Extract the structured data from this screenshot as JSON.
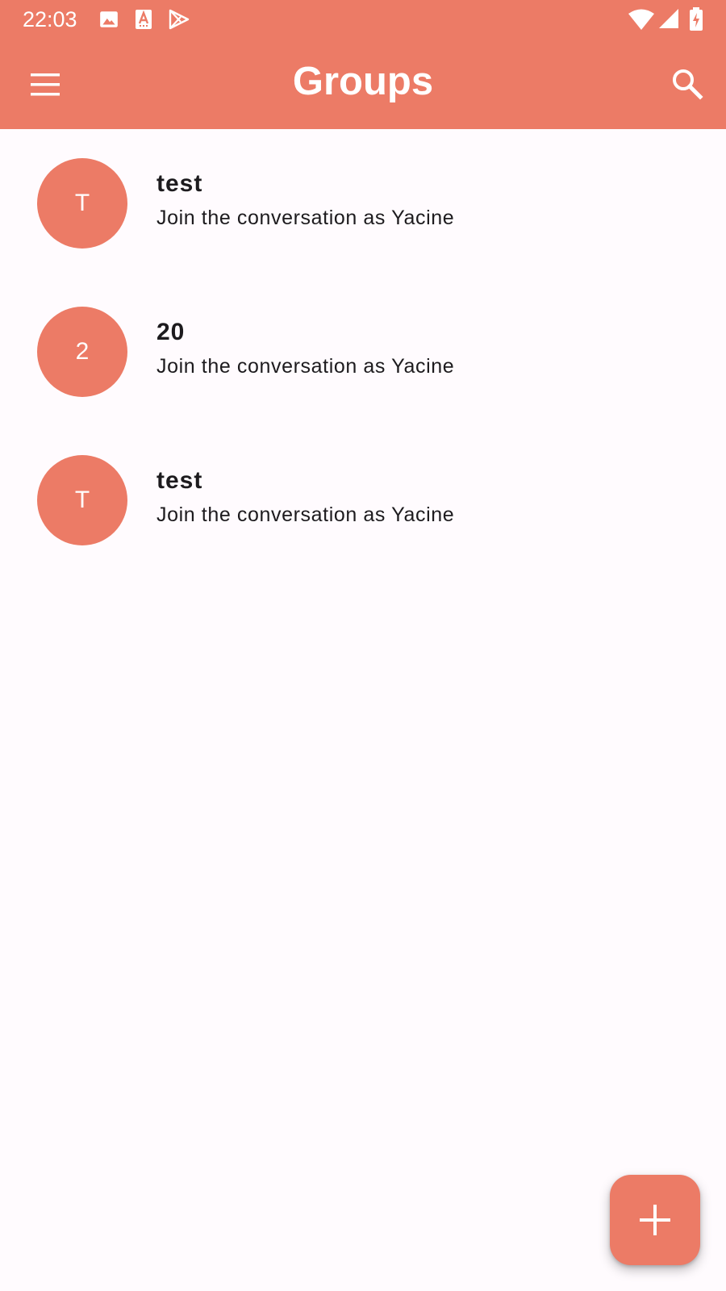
{
  "status_bar": {
    "time": "22:03",
    "left_icons": [
      "image-icon",
      "text-recognition-icon",
      "play-store-icon"
    ],
    "right_icons": [
      "wifi-icon",
      "signal-icon",
      "battery-charging-icon"
    ]
  },
  "app_bar": {
    "title": "Groups",
    "menu_icon": "menu-icon",
    "search_icon": "search-icon",
    "color": "#ec7b66"
  },
  "groups": [
    {
      "avatar_letter": "T",
      "name": "test",
      "subtitle": "Join the conversation as Yacine"
    },
    {
      "avatar_letter": "2",
      "name": "20",
      "subtitle": "Join the conversation as Yacine"
    },
    {
      "avatar_letter": "T",
      "name": "test",
      "subtitle": "Join the conversation as Yacine"
    }
  ],
  "fab": {
    "icon": "plus-icon",
    "color": "#ec7b66"
  },
  "colors": {
    "accent": "#ec7b66",
    "background": "#fffbfe",
    "text": "#1d1b1e"
  }
}
